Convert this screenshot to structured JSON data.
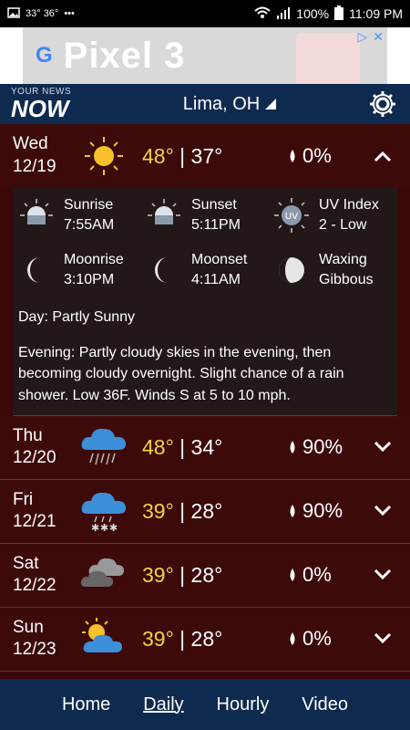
{
  "status_bar": {
    "temps": "33° 36°",
    "dots": "•••",
    "battery": "100%",
    "time": "11:09 PM"
  },
  "ad": {
    "brand_letter": "G",
    "text": "Pixel 3"
  },
  "header": {
    "logo_small": "YOUR NEWS",
    "logo_big": "NOW",
    "location": "Lima, OH"
  },
  "days": [
    {
      "day": "Wed",
      "date": "12/19",
      "icon": "sun-icon",
      "hi": "48°",
      "lo": "37°",
      "precip": "0%",
      "expanded": true
    },
    {
      "day": "Thu",
      "date": "12/20",
      "icon": "rain-cloud-icon",
      "hi": "48°",
      "lo": "34°",
      "precip": "90%",
      "expanded": false
    },
    {
      "day": "Fri",
      "date": "12/21",
      "icon": "snow-cloud-icon",
      "hi": "39°",
      "lo": "28°",
      "precip": "90%",
      "expanded": false
    },
    {
      "day": "Sat",
      "date": "12/22",
      "icon": "dark-clouds-icon",
      "hi": "39°",
      "lo": "28°",
      "precip": "0%",
      "expanded": false
    },
    {
      "day": "Sun",
      "date": "12/23",
      "icon": "partly-sunny-icon",
      "hi": "39°",
      "lo": "28°",
      "precip": "0%",
      "expanded": false
    }
  ],
  "details": {
    "sunrise_label": "Sunrise",
    "sunrise_value": "7:55AM",
    "sunset_label": "Sunset",
    "sunset_value": "5:11PM",
    "uv_label": "UV Index",
    "uv_value": "2 - Low",
    "uv_icon_text": "UV",
    "moonrise_label": "Moonrise",
    "moonrise_value": "3:10PM",
    "moonset_label": "Moonset",
    "moonset_value": "4:11AM",
    "phase_line1": "Waxing",
    "phase_line2": "Gibbous",
    "day_desc": "Day: Partly Sunny",
    "evening_desc": "Evening: Partly cloudy skies in the evening, then becoming cloudy overnight. Slight chance of a rain shower. Low 36F. Winds S at 5 to 10 mph."
  },
  "nav": {
    "home": "Home",
    "daily": "Daily",
    "hourly": "Hourly",
    "video": "Video"
  },
  "colors": {
    "header_bg": "#0f2a4f",
    "row_bg": "#3d0a0a",
    "hi_temp": "#f4d33f"
  }
}
